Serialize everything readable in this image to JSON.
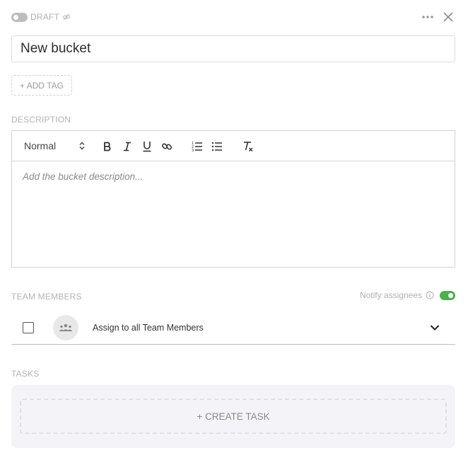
{
  "header": {
    "status_label": "DRAFT",
    "icons": [
      "draft-toggle",
      "eye-off-icon",
      "more-icon",
      "close-icon"
    ]
  },
  "title": {
    "value": "New bucket"
  },
  "tags": {
    "add_label": "+ ADD TAG"
  },
  "description": {
    "section_label": "DESCRIPTION",
    "format_value": "Normal",
    "placeholder": "Add the bucket description...",
    "toolbar_icons": [
      "bold-icon",
      "italic-icon",
      "underline-icon",
      "link-icon",
      "ordered-list-icon",
      "bullet-list-icon",
      "clear-format-icon"
    ]
  },
  "team": {
    "section_label": "TEAM MEMBERS",
    "notify_label": "Notify assignees",
    "notify_enabled": true,
    "assign_all_label": "Assign to all Team Members",
    "assign_all_checked": false
  },
  "tasks": {
    "section_label": "TASKS",
    "create_label": "+ CREATE TASK"
  },
  "colors": {
    "toggle_on": "#4caf50",
    "muted_text": "#b0b0b0",
    "tasks_bg": "#f4f4f8"
  }
}
